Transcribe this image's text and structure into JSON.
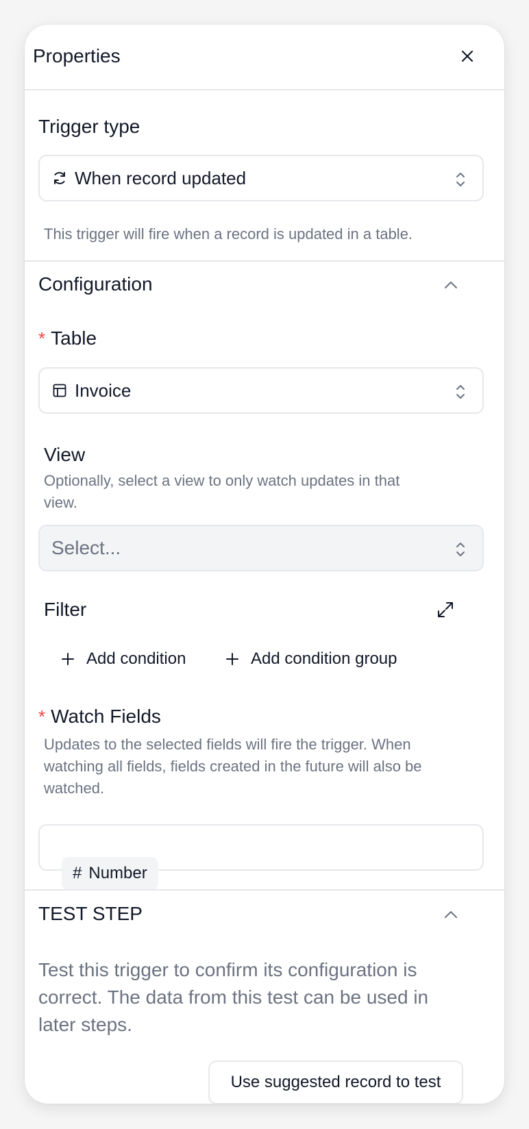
{
  "header": {
    "title": "Properties",
    "close_icon": "close-icon"
  },
  "trigger": {
    "label": "Trigger type",
    "selected": "When record updated",
    "icon": "refresh-icon",
    "description": "This trigger will fire when a record is updated in a table."
  },
  "configuration": {
    "title": "Configuration",
    "table": {
      "required_mark": "*",
      "label": "Table",
      "selected": "Invoice",
      "icon": "table-icon"
    },
    "view": {
      "label": "View",
      "help_line1": "Optionally, select a view to only watch updates in that",
      "help_line2": "view.",
      "placeholder": "Select..."
    },
    "filter": {
      "label": "Filter",
      "add_condition": "Add condition",
      "add_condition_group": "Add condition group"
    },
    "watch_fields": {
      "required_mark": "*",
      "label": "Watch Fields",
      "help_line1": "Updates to the selected fields will fire the trigger. When",
      "help_line2": "watching all fields, fields created in the future will also be",
      "help_line3": "watched.",
      "chips": [
        {
          "icon": "#",
          "label": "Number"
        }
      ]
    }
  },
  "test_step": {
    "title": "TEST STEP",
    "desc_line1": "Test this trigger to confirm its configuration is",
    "desc_line2": "correct. The data from this test can be used in",
    "desc_line3": "later steps.",
    "button_label": "Use suggested record to test"
  },
  "colors": {
    "required": "#ef4444",
    "muted_text": "#6b7280",
    "border": "#e5e7eb"
  }
}
